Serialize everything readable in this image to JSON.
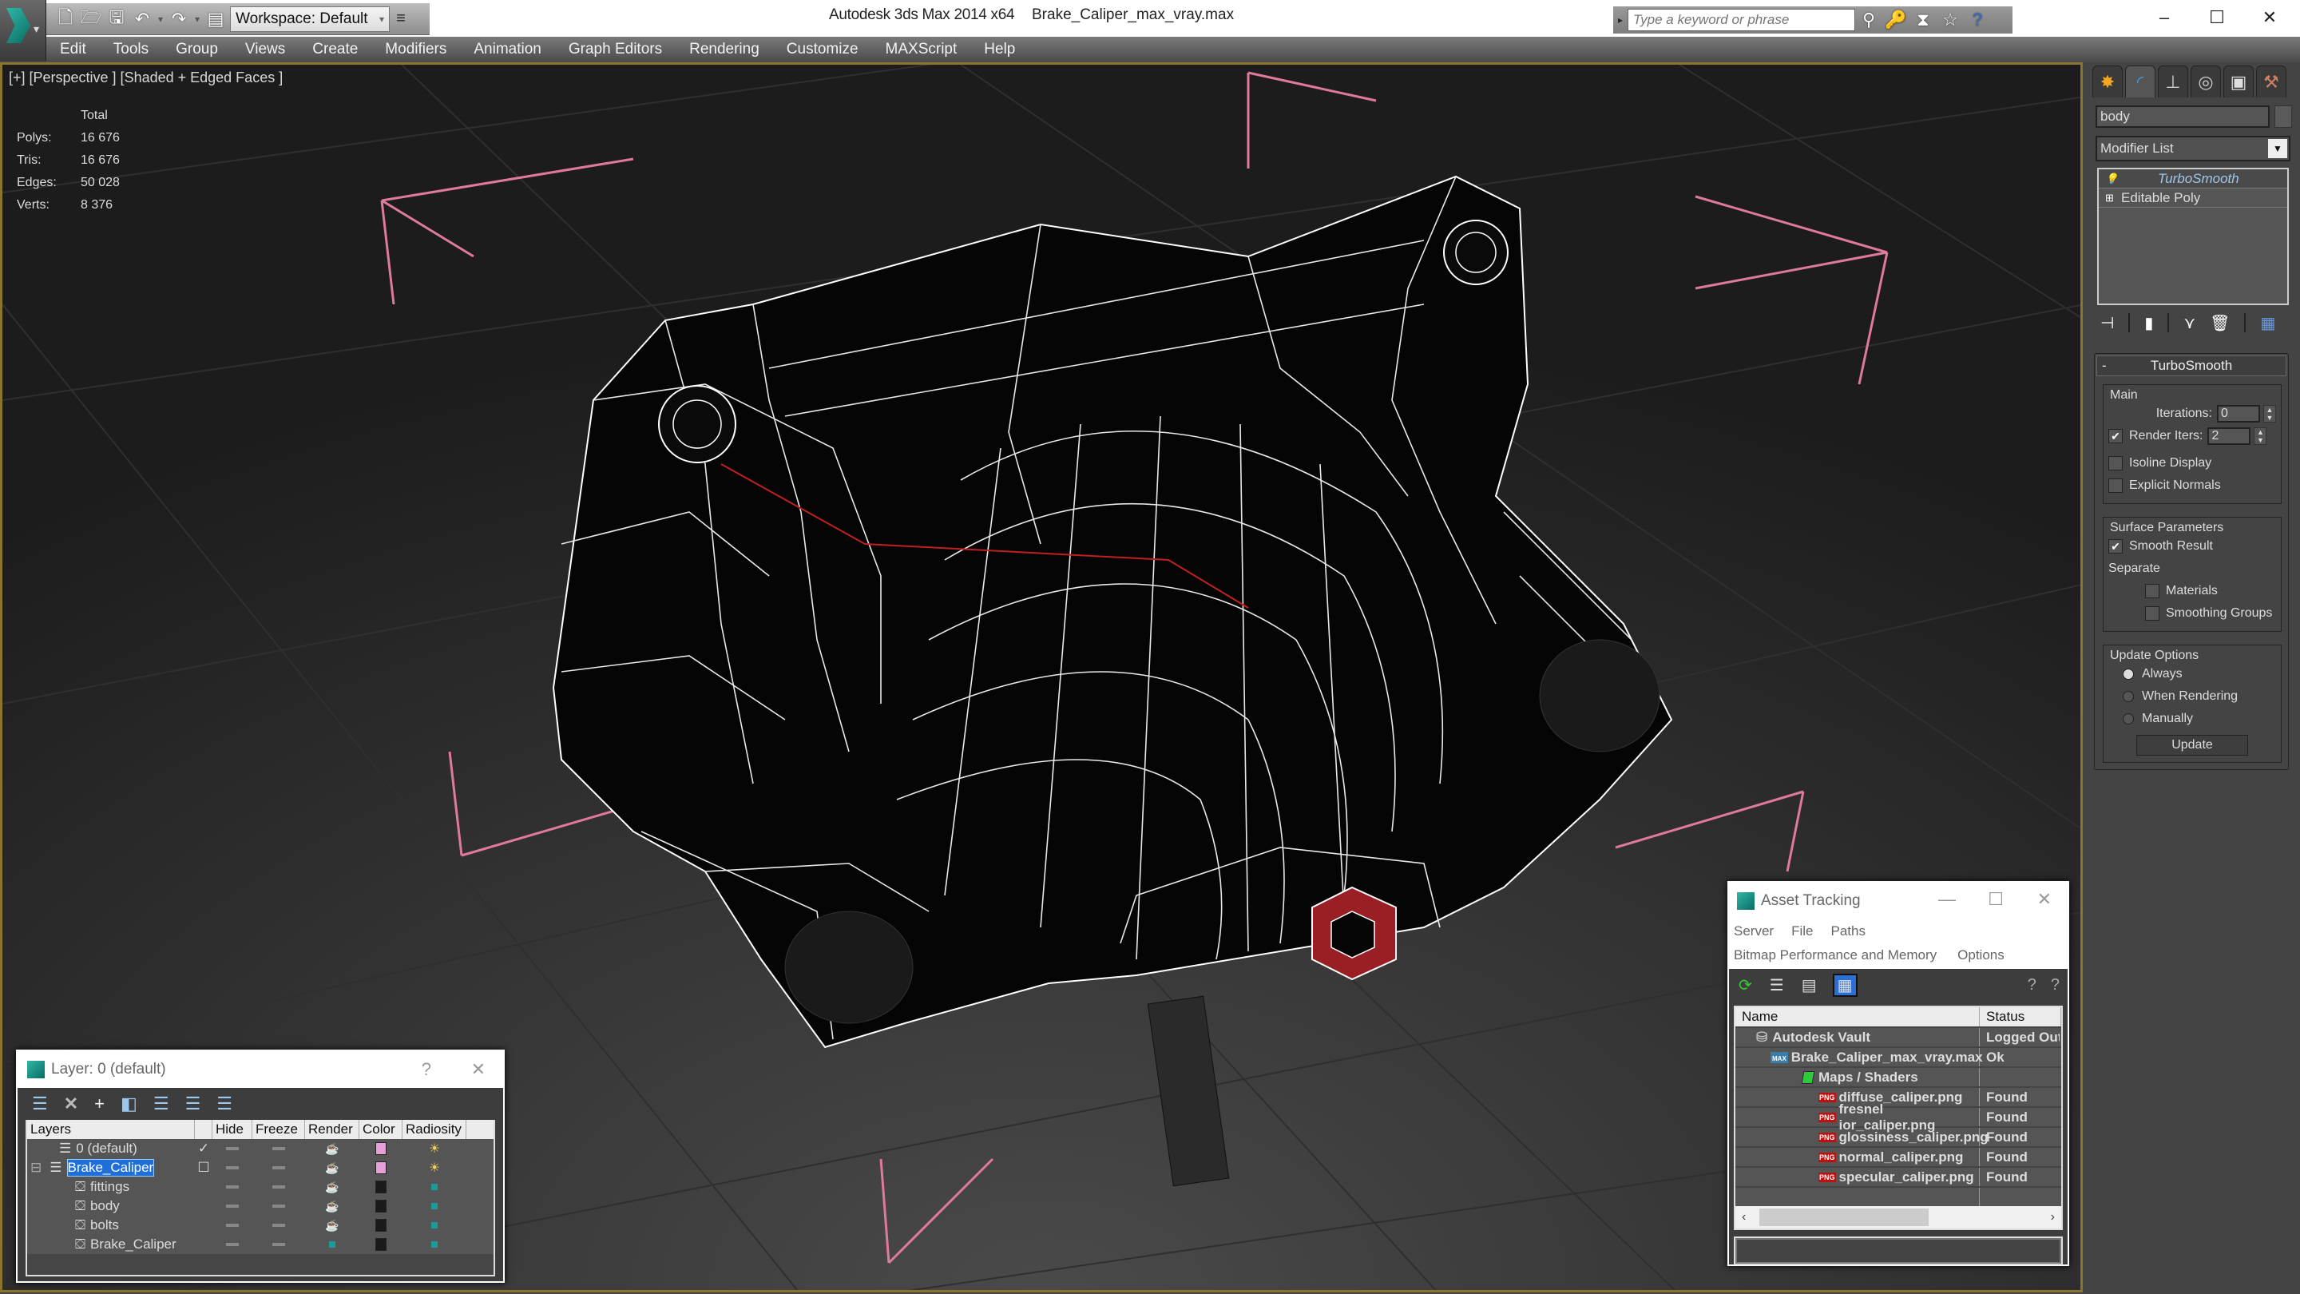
{
  "titlebar": {
    "app_title": "Autodesk 3ds Max  2014 x64",
    "file_title": "Brake_Caliper_max_vray.max",
    "workspace": "Workspace: Default",
    "search_placeholder": "Type a keyword or phrase",
    "minimize": "–",
    "maximize": "☐",
    "close": "✕"
  },
  "menu": [
    "Edit",
    "Tools",
    "Group",
    "Views",
    "Create",
    "Modifiers",
    "Animation",
    "Graph Editors",
    "Rendering",
    "Customize",
    "MAXScript",
    "Help"
  ],
  "viewport": {
    "label": "[+] [Perspective ] [Shaded + Edged Faces ]",
    "stats": {
      "header": "Total",
      "rows": [
        {
          "label": "Polys:",
          "value": "16 676"
        },
        {
          "label": "Tris:",
          "value": "16 676"
        },
        {
          "label": "Edges:",
          "value": "50 028"
        },
        {
          "label": "Verts:",
          "value": "8 376"
        }
      ]
    },
    "colors": {
      "stats": "#e6d23a",
      "border": "#8a7430",
      "wire": "#ffffff",
      "selection_box": "#e07a9a",
      "hex_highlight": "#b3262a"
    }
  },
  "command_panel": {
    "tabs": [
      "create-icon",
      "modify-icon",
      "hierarchy-icon",
      "motion-icon",
      "display-icon",
      "utilities-icon"
    ],
    "object_name": "body",
    "modifier_list": "Modifier List",
    "stack": [
      {
        "label": "TurboSmooth",
        "selected": true
      },
      {
        "label": "Editable Poly",
        "selected": false
      }
    ],
    "rollout": {
      "title": "TurboSmooth",
      "main": {
        "title": "Main",
        "iterations_label": "Iterations:",
        "iterations": "0",
        "render_iters_label": "Render Iters:",
        "render_iters": "2",
        "render_iters_checked": true,
        "isoline_label": "Isoline Display",
        "isoline_checked": false,
        "explicit_label": "Explicit Normals",
        "explicit_checked": false
      },
      "surface": {
        "title": "Surface Parameters",
        "smooth_label": "Smooth Result",
        "smooth_checked": true,
        "separate_label": "Separate",
        "materials_label": "Materials",
        "smoothing_groups_label": "Smoothing Groups"
      },
      "update": {
        "title": "Update Options",
        "options": [
          "Always",
          "When Rendering",
          "Manually"
        ],
        "selected": "Always",
        "button": "Update"
      }
    }
  },
  "layer_dialog": {
    "title": "Layer: 0 (default)",
    "help": "?",
    "close": "✕",
    "columns": [
      "Layers",
      "",
      "Hide",
      "Freeze",
      "Render",
      "Color",
      "Radiosity"
    ],
    "rows": [
      {
        "name": "0 (default)",
        "type": "layer",
        "current": true,
        "color": "#e6a0d8",
        "render": "teapot",
        "radiosity": "sun"
      },
      {
        "name": "Brake_Caliper",
        "type": "layer",
        "selected": true,
        "color": "#e6a0d8",
        "render": "teapot",
        "radiosity": "sun"
      },
      {
        "name": "fittings",
        "type": "object",
        "color": "#1a1a1a",
        "render": "teapot",
        "radiosity": "dot"
      },
      {
        "name": "body",
        "type": "object",
        "color": "#1a1a1a",
        "render": "teapot",
        "radiosity": "dot"
      },
      {
        "name": "bolts",
        "type": "object",
        "color": "#1a1a1a",
        "render": "teapot",
        "radiosity": "dot"
      },
      {
        "name": "Brake_Caliper",
        "type": "object",
        "color": "#1a1a1a",
        "render": "dot",
        "radiosity": "dot"
      }
    ]
  },
  "asset_dialog": {
    "title": "Asset Tracking",
    "menu_row1": [
      "Server",
      "File",
      "Paths"
    ],
    "menu_row2": [
      "Bitmap Performance and Memory",
      "Options"
    ],
    "columns": [
      "Name",
      "Status"
    ],
    "rows": [
      {
        "name": "Autodesk Vault",
        "status": "Logged Out",
        "icon": "vault",
        "indent": 1
      },
      {
        "name": "Brake_Caliper_max_vray.max",
        "status": "Ok",
        "icon": "max",
        "indent": 2
      },
      {
        "name": "Maps / Shaders",
        "status": "",
        "icon": "maps",
        "indent": 3
      },
      {
        "name": "diffuse_caliper.png",
        "status": "Found",
        "icon": "png",
        "indent": 4
      },
      {
        "name": "fresnel ior_caliper.png",
        "status": "Found",
        "icon": "png",
        "indent": 4
      },
      {
        "name": "glossiness_caliper.png",
        "status": "Found",
        "icon": "png",
        "indent": 4
      },
      {
        "name": "normal_caliper.png",
        "status": "Found",
        "icon": "png",
        "indent": 4
      },
      {
        "name": "specular_caliper.png",
        "status": "Found",
        "icon": "png",
        "indent": 4
      }
    ]
  }
}
